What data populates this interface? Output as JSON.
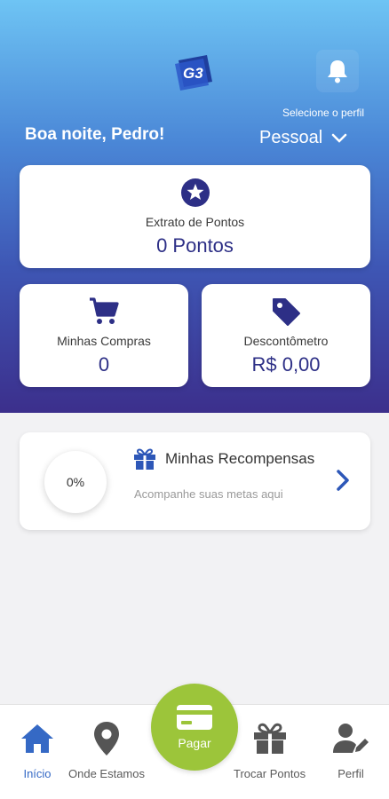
{
  "header": {
    "logo_text": "G3",
    "profile_caption": "Selecione o perfil",
    "greeting": "Boa noite, Pedro!",
    "profile_value": "Pessoal"
  },
  "cards": {
    "points": {
      "label": "Extrato de Pontos",
      "value": "0 Pontos",
      "icon": "star-icon"
    },
    "purchases": {
      "label": "Minhas Compras",
      "value": "0",
      "icon": "cart-icon"
    },
    "discount": {
      "label": "Descontômetro",
      "value": "R$ 0,00",
      "icon": "tag-icon"
    }
  },
  "rewards": {
    "progress": "0%",
    "title": "Minhas Recompensas",
    "subtitle": "Acompanhe suas metas aqui"
  },
  "bottom_nav": {
    "home": "Início",
    "locations": "Onde Estamos",
    "pay": "Pagar",
    "exchange": "Trocar Pontos",
    "profile": "Perfil"
  },
  "colors": {
    "accent": "#2d2f86",
    "active_nav": "#3569c5",
    "pay_button": "#9cc53a",
    "gradient_top": "#6ec4f4",
    "gradient_bottom": "#3c2f8c"
  }
}
